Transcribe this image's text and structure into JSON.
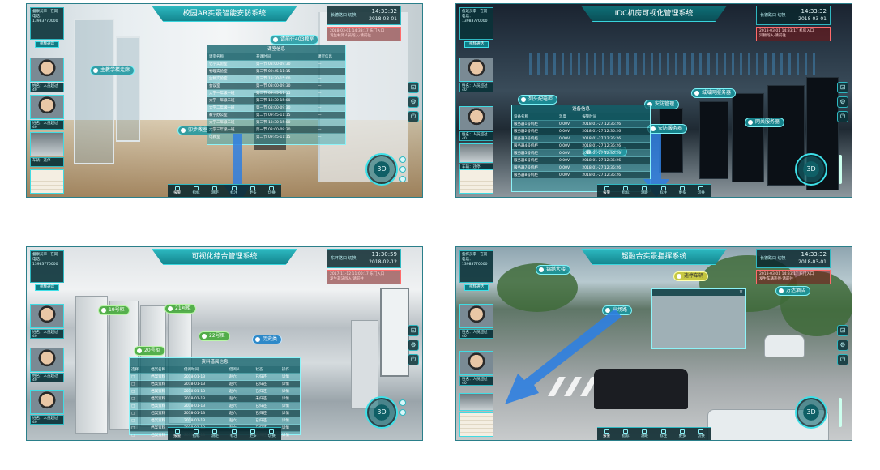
{
  "panels": [
    {
      "title": "校园AR实景智能安防系统",
      "clock_time": "14:33:32",
      "clock_date": "2018-03-01",
      "location": "长德路口·切换",
      "alert_line1": "2018-03-01 14:33:17 东门入口",
      "alert_line2": "发生村外人员闯入·请前往",
      "user_line1": "督察员李 · 在岗",
      "user_line2": "电话：13983770000",
      "user_button": "视频通话",
      "caption1": "姓名：人员超过40",
      "caption2": "姓名：人员超过40",
      "caption3": "车辆：违停",
      "tags": [
        "主教学楼走廊",
        "请前往403教室",
        "卯步教室"
      ],
      "table_title": "课室信息",
      "table_headers": [
        "课室名称",
        "开课时间",
        "课室信息"
      ],
      "table_rows": [
        [
          "化学实验室",
          "第一节 08:00-09:30",
          "—"
        ],
        [
          "物理实验室",
          "第二节 09:45-11:15",
          "—"
        ],
        [
          "生物实验室",
          "第三节 13:30-15:00",
          "—"
        ],
        [
          "会议室",
          "第一节 08:00-09:30",
          "—"
        ],
        [
          "大学一年级一班",
          "第二节 09:45-11:15",
          "—"
        ],
        [
          "大学一年级二班",
          "第三节 13:30-15:00",
          "—"
        ],
        [
          "大学二年级一班",
          "第一节 08:00-09:30",
          "—"
        ],
        [
          "教学办公室",
          "第二节 09:45-11:15",
          "—"
        ],
        [
          "大学二年级二班",
          "第三节 13:30-15:00",
          "—"
        ],
        [
          "大学三年级一班",
          "第一节 08:00-09:30",
          "—"
        ],
        [
          "电教室",
          "第二节 09:45-11:15",
          "—"
        ]
      ],
      "toolbar": [
        "报警",
        "指标",
        "测距",
        "标注",
        "更多",
        "切换"
      ]
    },
    {
      "title": "IDC机房可视化管理系统",
      "clock_time": "14:33:32",
      "clock_date": "2018-03-01",
      "location": "长德路口·切换",
      "alert_line1": "2018-03-01 14:33:17 机房入口",
      "alert_line2": "异物闯入·请前往",
      "user_line1": "值班员李 · 在岗",
      "user_line2": "电话：13983770000",
      "user_button": "视频通话",
      "caption1": "姓名：人员超过40",
      "caption2": "姓名：人员超过40",
      "caption3": "车辆：违停",
      "tags": [
        "列头配电柜",
        "安防管理",
        "城域网服务器",
        "网关服务器",
        "安防服务器",
        "机房监控中心"
      ],
      "table_title": "设备信息",
      "table_headers": [
        "设备名称",
        "温度",
        "报警时间"
      ],
      "table_rows": [
        [
          "服务器1号机柜",
          "0.00V",
          "2018-01-27 12:35:26"
        ],
        [
          "服务器2号机柜",
          "0.00V",
          "2018-01-27 12:35:26"
        ],
        [
          "服务器3号机柜",
          "0.00V",
          "2018-01-27 12:35:26"
        ],
        [
          "服务器4号机柜",
          "0.00V",
          "2018-01-27 12:35:26"
        ],
        [
          "服务器5号机柜",
          "0.00V",
          "2018-01-27 12:35:26"
        ],
        [
          "服务器6号机柜",
          "0.00V",
          "2018-01-27 12:35:26"
        ],
        [
          "服务器7号机柜",
          "0.00V",
          "2018-01-27 12:35:26"
        ],
        [
          "服务器8号机柜",
          "0.00V",
          "2018-01-27 12:35:26"
        ]
      ],
      "toolbar": [
        "报警",
        "指标",
        "测距",
        "标注",
        "更多",
        "切换"
      ]
    },
    {
      "title": "可视化综合管理系统",
      "clock_time": "11:30:59",
      "clock_date": "2018-02-12",
      "location": "东环路口·切换",
      "alert_line1": "2017-11-12 11:00:17 东门入口",
      "alert_line2": "发生非法闯入·请前往",
      "user_line1": "督察员李 · 在岗",
      "user_line2": "电话：13983770000",
      "user_button": "视频通话",
      "caption1": "姓名：人员超过40",
      "caption2": "姓名：人员超过40",
      "caption3": "姓名：人员超过40",
      "tags": [
        "19号柜",
        "21号柜",
        "22号柜",
        "20号柜",
        "历史类"
      ],
      "table_title": "资料借阅信息",
      "table_headers": [
        "选择",
        "档案名称",
        "借阅时间",
        "借阅人",
        "状态",
        "操作"
      ],
      "table_rows": [
        [
          "□",
          "档案资料",
          "2018-01-13",
          "赵六",
          "已归还",
          "详情"
        ],
        [
          "□",
          "档案资料",
          "2018-01-13",
          "赵六",
          "已归还",
          "详情"
        ],
        [
          "□",
          "档案资料",
          "2018-01-13",
          "赵六",
          "已归还",
          "详情"
        ],
        [
          "□",
          "档案资料",
          "2018-01-13",
          "赵六",
          "未归还",
          "详情"
        ],
        [
          "□",
          "档案资料",
          "2018-01-13",
          "赵六",
          "已归还",
          "详情"
        ],
        [
          "□",
          "档案资料",
          "2018-01-13",
          "赵六",
          "已归还",
          "详情"
        ],
        [
          "□",
          "档案资料",
          "2018-01-13",
          "赵六",
          "已归还",
          "详情"
        ],
        [
          "□",
          "档案资料",
          "2018-01-13",
          "赵六",
          "已归还",
          "详情"
        ],
        [
          "□",
          "档案资料",
          "2018-01-13",
          "赵六",
          "已归还",
          "详情"
        ]
      ],
      "toolbar": [
        "报警",
        "指标",
        "测距",
        "标注",
        "更多",
        "切换"
      ]
    },
    {
      "title": "超融合实景指挥系统",
      "clock_time": "14:33:32",
      "clock_date": "2018-03-01",
      "location": "长德路口·切换",
      "alert_line1": "2018-03-01 14:33:17 东门入口",
      "alert_line2": "发生车辆违停·请前往",
      "user_line1": "指挥员李 · 在岗",
      "user_line2": "电话：13983770000",
      "user_button": "视频通话",
      "caption1": "姓名：人员超过40",
      "caption2": "姓名：人员超过40",
      "caption3": "车辆：违停",
      "tags": [
        "锦绣大楼",
        "违停车辆",
        "万达酒店",
        "出场路"
      ],
      "table_title": "",
      "table_headers": [],
      "table_rows": [],
      "toolbar": [
        "报警",
        "指标",
        "测距",
        "标注",
        "更多",
        "切换"
      ]
    }
  ],
  "colors": {
    "accent": "#2fb8c1",
    "panel": "#0a4f57",
    "alert": "#ff6b6b",
    "arrow": "#2f7fe0"
  },
  "compass_label": "3D"
}
